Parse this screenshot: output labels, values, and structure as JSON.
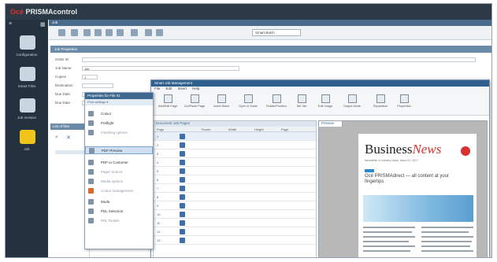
{
  "app": {
    "brand_prefix": "Océ",
    "brand_name": "PRISMAcontrol"
  },
  "top_strip": {
    "label": "Job"
  },
  "nav": [
    {
      "label": "Configuration"
    },
    {
      "label": "Smart Files"
    },
    {
      "label": "Job revision"
    },
    {
      "label": "Job"
    }
  ],
  "toolbar": {
    "select_value": "Smart Batch"
  },
  "section": {
    "title": "Job Properties"
  },
  "form": {
    "rows": [
      {
        "label": "Order ID",
        "value": ""
      },
      {
        "label": "Job Name",
        "value": "Job"
      },
      {
        "label": "Copies",
        "value": "1"
      },
      {
        "label": "Destination",
        "value": ""
      },
      {
        "label": "Due Date",
        "value": ""
      },
      {
        "label": "Due Date",
        "value": ""
      }
    ]
  },
  "left_pane": {
    "header": "List of files"
  },
  "popup": {
    "title": "Properties for File 01",
    "subtitle": "Print settings ▾",
    "items": [
      {
        "label": "Colour"
      },
      {
        "label": "Preflight"
      },
      {
        "label": "Finishing options"
      },
      {
        "label": "PDF Preview"
      },
      {
        "label": "PDF to Customer"
      },
      {
        "label": "Paper Source"
      },
      {
        "label": "Media options"
      },
      {
        "label": "Colour management"
      },
      {
        "label": "Mode"
      },
      {
        "label": "PDL Selection"
      },
      {
        "label": "PDL Details"
      }
    ]
  },
  "dialog": {
    "title": "Smart Job Management",
    "menu": [
      "File",
      "Edit",
      "Insert",
      "Help"
    ],
    "ribbon": [
      {
        "label": "Add/Edit Page"
      },
      {
        "label": "Cut/Paste Page"
      },
      {
        "label": "Insert Blank"
      },
      {
        "label": "Open & Scale"
      },
      {
        "label": "Rotate/Position"
      },
      {
        "label": "Set Tab"
      },
      {
        "label": "Edit Image"
      },
      {
        "label": "Output Mode"
      },
      {
        "label": "Separation"
      },
      {
        "label": "Properties"
      }
    ],
    "grid": {
      "title": "Document Job Pages",
      "headers": [
        "Page",
        "Thumb",
        "Width",
        "Height",
        "Page"
      ],
      "rows": [
        "1",
        "2",
        "3",
        "4",
        "5",
        "6",
        "7",
        "8",
        "9",
        "10",
        "11",
        "12",
        "13"
      ]
    },
    "preview": {
      "tab": "Preview"
    }
  },
  "newsletter": {
    "title_a": "Business",
    "title_b": "News",
    "subline": "Newsletter & Industry News, Issue 01, 2017",
    "headline": "Océ PRISMAdirect — all content at your fingertips"
  },
  "colors": {
    "titlebar": "#2c3a48",
    "accent_red": "#d8322e",
    "dialog_head": "#2f5f8c"
  }
}
